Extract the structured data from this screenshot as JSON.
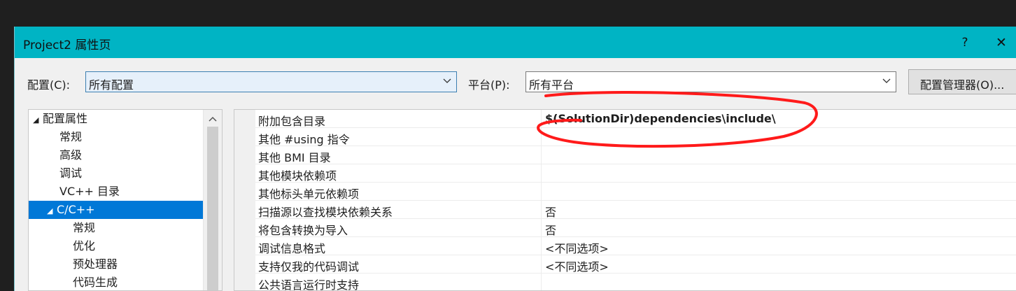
{
  "window": {
    "title": "Project2 属性页",
    "help_label": "?",
    "close_label": "✕"
  },
  "toolbar": {
    "config_label": "配置(C):",
    "config_value": "所有配置",
    "platform_label": "平台(P):",
    "platform_value": "所有平台",
    "manager_button": "配置管理器(O)..."
  },
  "tree": {
    "items": [
      {
        "label": "配置属性",
        "expander": "◢"
      },
      {
        "label": "常规"
      },
      {
        "label": "高级"
      },
      {
        "label": "调试"
      },
      {
        "label": "VC++ 目录"
      },
      {
        "label": "C/C++",
        "expander": "◢",
        "selected": true
      },
      {
        "label": "常规"
      },
      {
        "label": "优化"
      },
      {
        "label": "预处理器"
      },
      {
        "label": "代码生成"
      }
    ]
  },
  "properties": {
    "rows": [
      {
        "name": "附加包含目录",
        "value": "$(SolutionDir)dependencies\\include\\"
      },
      {
        "name": "其他 #using 指令",
        "value": ""
      },
      {
        "name": "其他 BMI 目录",
        "value": ""
      },
      {
        "name": "其他模块依赖项",
        "value": ""
      },
      {
        "name": "其他标头单元依赖项",
        "value": ""
      },
      {
        "name": "扫描源以查找模块依赖关系",
        "value": "否"
      },
      {
        "name": "将包含转换为导入",
        "value": "否"
      },
      {
        "name": "调试信息格式",
        "value": "<不同选项>"
      },
      {
        "name": "支持仅我的代码调试",
        "value": "<不同选项>"
      },
      {
        "name": "公共语言运行时支持",
        "value": ""
      }
    ]
  },
  "colors": {
    "titlebar": "#00b4c4",
    "selection": "#0078d7",
    "annotation": "#ff1a1a"
  }
}
